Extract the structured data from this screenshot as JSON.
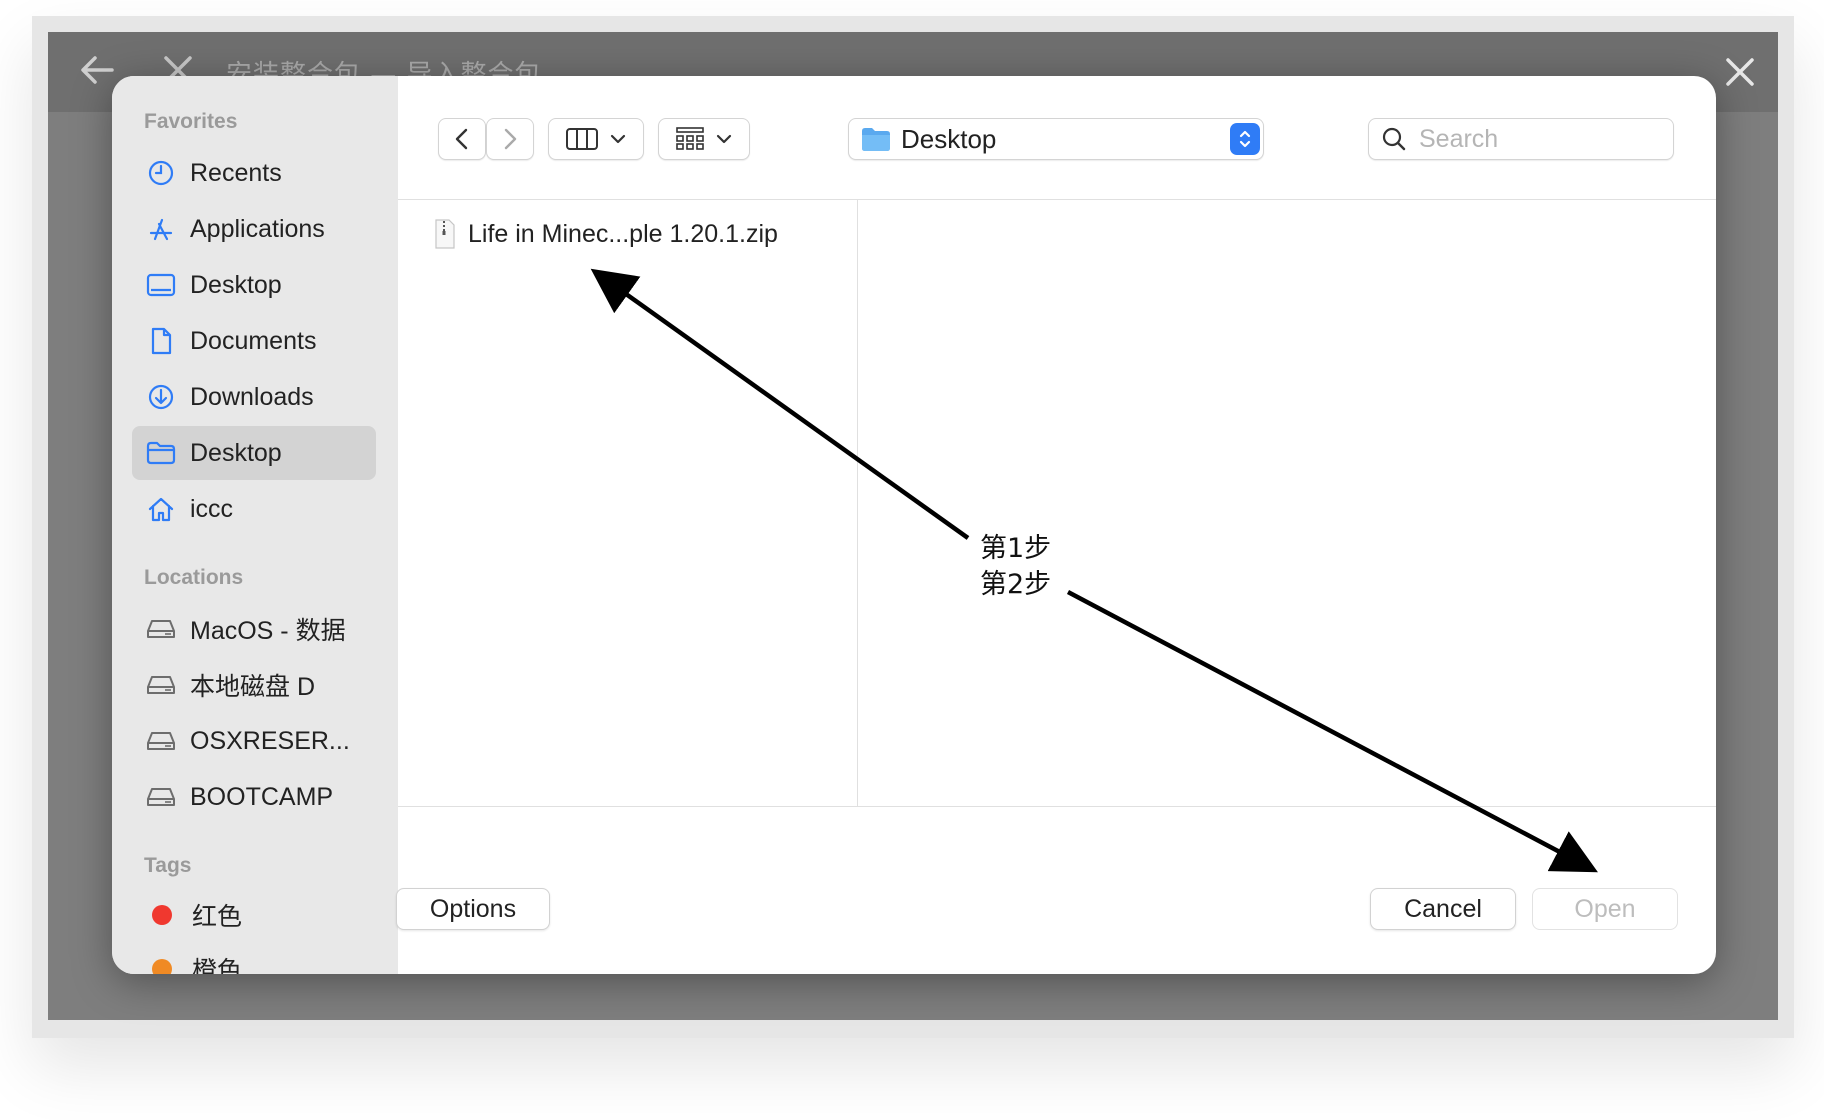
{
  "backdrop": {
    "title": "安装整合包 — 导入整合包"
  },
  "sidebar": {
    "favorites_title": "Favorites",
    "locations_title": "Locations",
    "tags_title": "Tags",
    "favorites": [
      {
        "label": "Recents",
        "icon": "clock-icon"
      },
      {
        "label": "Applications",
        "icon": "applications-icon"
      },
      {
        "label": "Desktop",
        "icon": "desktop-icon"
      },
      {
        "label": "Documents",
        "icon": "document-icon"
      },
      {
        "label": "Downloads",
        "icon": "download-icon"
      },
      {
        "label": "Desktop",
        "icon": "folder-icon",
        "selected": true
      },
      {
        "label": "iccc",
        "icon": "home-icon"
      }
    ],
    "locations": [
      {
        "label": "MacOS - 数据",
        "icon": "drive-icon"
      },
      {
        "label": "本地磁盘 D",
        "icon": "drive-icon"
      },
      {
        "label": "OSXRESER...",
        "icon": "drive-icon"
      },
      {
        "label": "BOOTCAMP",
        "icon": "drive-icon"
      }
    ],
    "tags": [
      {
        "label": "红色",
        "color": "#f0382f"
      },
      {
        "label": "橙色",
        "color": "#f08a24"
      }
    ]
  },
  "toolbar": {
    "location": "Desktop",
    "search_placeholder": "Search"
  },
  "files": [
    {
      "name": "Life in Minec...ple 1.20.1.zip",
      "icon": "zip-file-icon"
    }
  ],
  "buttons": {
    "options": "Options",
    "cancel": "Cancel",
    "open": "Open"
  },
  "annotations": {
    "step1": "第1步",
    "step2": "第2步"
  },
  "colors": {
    "accent": "#2f7cf6",
    "sidebar_icon": "#2f7cf6"
  }
}
